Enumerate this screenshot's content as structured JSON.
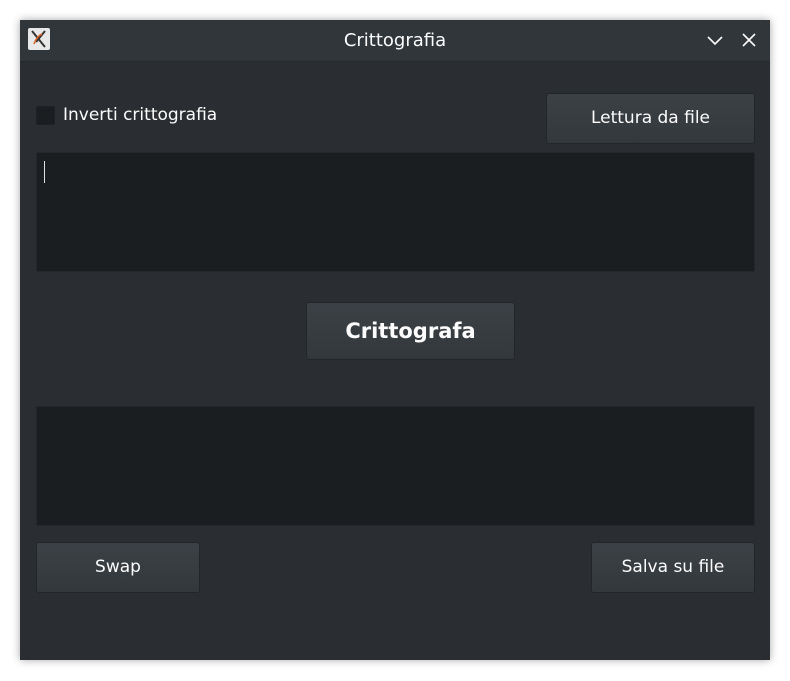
{
  "window": {
    "title": "Crittografia",
    "icon": "app-icon"
  },
  "titlebar_buttons": {
    "minimize_icon": "chevron-down-icon",
    "close_icon": "close-icon"
  },
  "options": {
    "invert_label": "Inverti crittografia",
    "invert_checked": false
  },
  "buttons": {
    "read_file": "Lettura da file",
    "encrypt": "Crittografa",
    "swap": "Swap",
    "save_file": "Salva su file"
  },
  "input_text": "",
  "output_text": "",
  "colors": {
    "window_bg": "#2a2e32",
    "titlebar_bg": "#31363b",
    "field_bg": "#1b1e20",
    "text": "#fcfcfc"
  }
}
